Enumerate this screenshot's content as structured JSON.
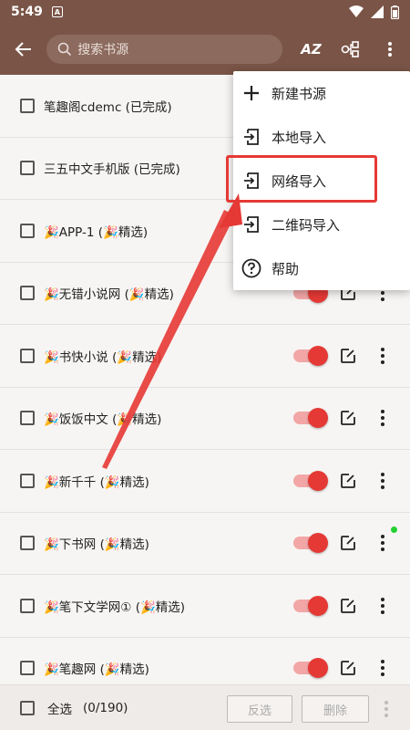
{
  "status_bar": {
    "time": "5:49",
    "notif": "A"
  },
  "toolbar": {
    "search_placeholder": "搜索书源",
    "sort_label": "AZ"
  },
  "rows": [
    {
      "label": "笔趣阁cdemc (已完成)",
      "toggle": false
    },
    {
      "label": "三五中文手机版 (已完成)",
      "toggle": false
    },
    {
      "label": "🎉APP-1 (🎉精选)",
      "toggle": false
    },
    {
      "label": "🎉无错小说网 (🎉精选)",
      "toggle": true
    },
    {
      "label": "🎉书快小说 (🎉精选)",
      "toggle": true
    },
    {
      "label": "🎉饭饭中文 (🎉精选)",
      "toggle": true
    },
    {
      "label": "🎉新千千 (🎉精选)",
      "toggle": true
    },
    {
      "label": "🎉下书网 (🎉精选)",
      "toggle": true
    },
    {
      "label": "🎉笔下文学网① (🎉精选)",
      "toggle": true
    },
    {
      "label": "🎉笔趣网 (🎉精选)",
      "toggle": true
    }
  ],
  "menu": {
    "items": [
      {
        "label": "新建书源",
        "icon": "plus-icon"
      },
      {
        "label": "本地导入",
        "icon": "import-icon"
      },
      {
        "label": "网络导入",
        "icon": "import-icon"
      },
      {
        "label": "二维码导入",
        "icon": "import-icon"
      },
      {
        "label": "帮助",
        "icon": "help-icon"
      }
    ]
  },
  "bottom": {
    "select_all": "全选",
    "count": "(0/190)",
    "invert": "反选",
    "delete": "删除"
  },
  "colors": {
    "toolbar": "#7a5547",
    "accent": "#e53935",
    "highlight": "#e53935"
  }
}
